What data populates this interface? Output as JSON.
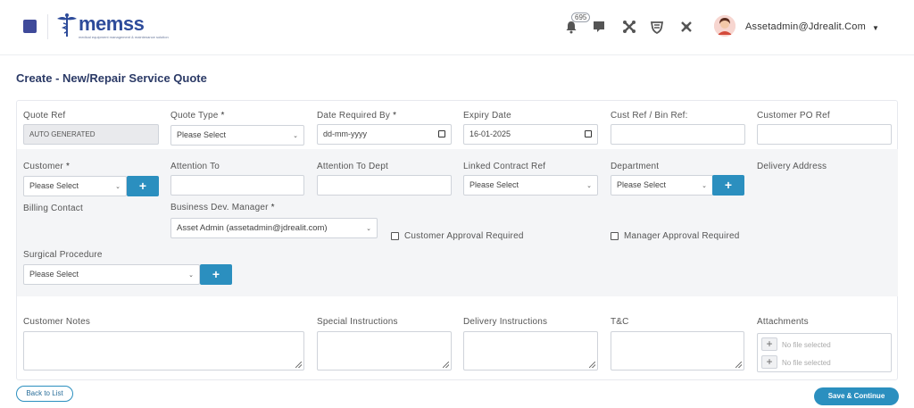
{
  "header": {
    "logo_text": "memss",
    "logo_tagline": "medical equipment management & maintenance solution",
    "notification_count": "695",
    "user_email": "Assetadmin@Jdrealit.Com"
  },
  "page": {
    "title": "Create - New/Repair Service Quote"
  },
  "form": {
    "quote_ref": {
      "label": "Quote Ref",
      "value": "AUTO GENERATED"
    },
    "quote_type": {
      "label": "Quote Type",
      "value": "Please Select"
    },
    "date_required_by": {
      "label": "Date Required By",
      "value": "dd-mm-yyyy"
    },
    "expiry_date": {
      "label": "Expiry Date",
      "value": "16-01-2025"
    },
    "cust_ref": {
      "label": "Cust Ref / Bin Ref:",
      "value": ""
    },
    "customer_po_ref": {
      "label": "Customer PO Ref",
      "value": ""
    },
    "customer": {
      "label": "Customer",
      "value": "Please Select"
    },
    "attention_to": {
      "label": "Attention To",
      "value": ""
    },
    "attention_to_dept": {
      "label": "Attention To Dept",
      "value": ""
    },
    "linked_contract_ref": {
      "label": "Linked Contract Ref",
      "value": "Please Select"
    },
    "department": {
      "label": "Department",
      "value": "Please Select"
    },
    "delivery_address": {
      "label": "Delivery Address"
    },
    "billing_contact": {
      "label": "Billing Contact"
    },
    "business_dev_manager": {
      "label": "Business Dev. Manager",
      "value": "Asset Admin (assetadmin@jdrealit.com)"
    },
    "customer_approval": {
      "label": "Customer Approval Required",
      "checked": false
    },
    "manager_approval": {
      "label": "Manager Approval Required",
      "checked": false
    },
    "surgical_procedure": {
      "label": "Surgical Procedure",
      "value": "Please Select"
    },
    "customer_notes": {
      "label": "Customer Notes"
    },
    "special_instructions": {
      "label": "Special Instructions"
    },
    "delivery_instructions": {
      "label": "Delivery Instructions"
    },
    "tandc": {
      "label": "T&C"
    },
    "attachments": {
      "label": "Attachments",
      "file1": "No file selected",
      "file2": "No file selected"
    },
    "required_mark": "*",
    "add_symbol": "+",
    "file_add_symbol": "+"
  },
  "actions": {
    "back_label": "Back to List",
    "save_label": "Save & Continue"
  },
  "colors": {
    "accent": "#2b8fbf",
    "title": "#2b3a66",
    "brand": "#3f4a9a"
  }
}
